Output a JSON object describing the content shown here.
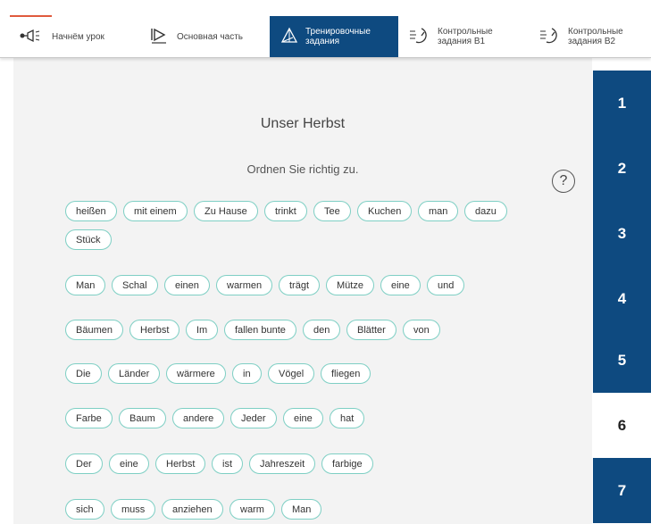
{
  "nav": {
    "tabs": [
      {
        "label": "Начнём урок",
        "icon": "megaphone-icon"
      },
      {
        "label": "Основная часть",
        "icon": "play-icon"
      },
      {
        "label": "Тренировочные задания",
        "icon": "pyramid-icon",
        "active": true
      },
      {
        "label": "Контрольные задания В1",
        "icon": "timer-icon"
      },
      {
        "label": "Контрольные задания В2",
        "icon": "timer-icon"
      }
    ]
  },
  "side_nav": [
    "1",
    "2",
    "3",
    "4",
    "5",
    "6",
    "7"
  ],
  "side_nav_current": "6",
  "main": {
    "title": "Unser Herbst",
    "instruction": "Ordnen Sie richtig zu.",
    "help_symbol": "?"
  },
  "exercises": [
    [
      "heißen",
      "mit einem",
      "Zu Hause",
      "trinkt",
      "Tee",
      "Kuchen",
      "man",
      "dazu",
      "Stück"
    ],
    [
      "Man",
      "Schal",
      "einen",
      "warmen",
      "trägt",
      "Mütze",
      "eine",
      "und"
    ],
    [
      "Bäumen",
      "Herbst",
      "Im",
      "fallen bunte",
      "den",
      "Blätter",
      "von"
    ],
    [
      "Die",
      "Länder",
      "wärmere",
      "in",
      "Vögel",
      "fliegen"
    ],
    [
      "Farbe",
      "Baum",
      "andere",
      "Jeder",
      "eine",
      "hat"
    ],
    [
      "Der",
      "eine",
      "Herbst",
      "ist",
      "Jahreszeit",
      "farbige"
    ],
    [
      "sich",
      "muss",
      "anziehen",
      "warm",
      "Man"
    ]
  ],
  "colors": {
    "accent": "#0e4a80",
    "chip_border": "#7ecfc4",
    "progress_line": "#e05a3d"
  }
}
